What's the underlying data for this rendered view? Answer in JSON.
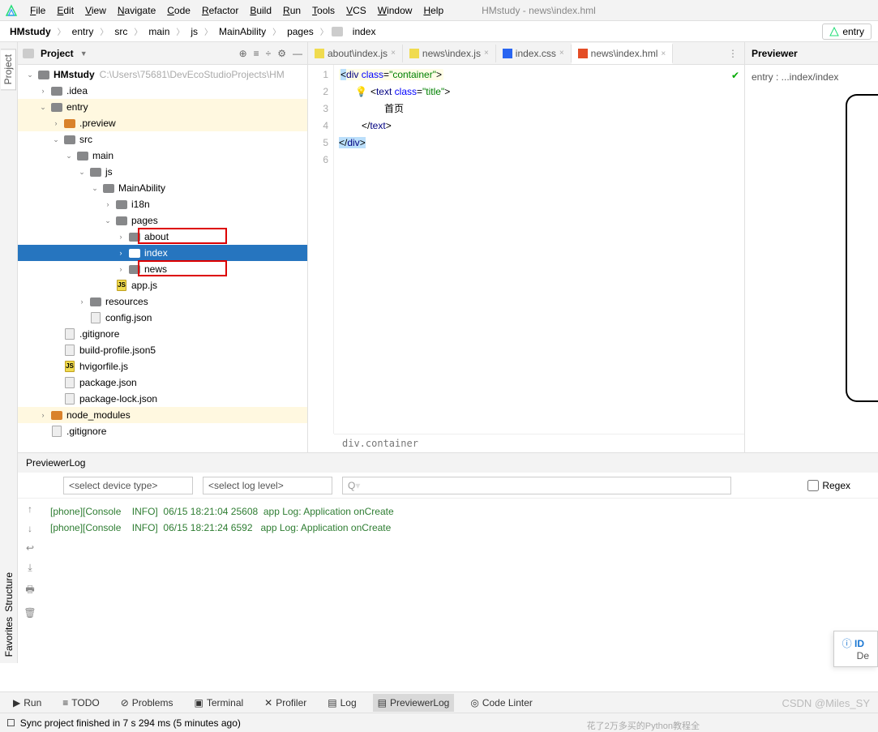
{
  "window_title_path": "HMstudy - news\\index.hml",
  "menubar": [
    "File",
    "Edit",
    "View",
    "Navigate",
    "Code",
    "Refactor",
    "Build",
    "Run",
    "Tools",
    "VCS",
    "Window",
    "Help"
  ],
  "breadcrumbs": [
    "HMstudy",
    "entry",
    "src",
    "main",
    "js",
    "MainAbility",
    "pages",
    "index"
  ],
  "entry_tag": "entry",
  "left_rail_tabs": {
    "project": "Project",
    "structure": "Structure",
    "favorites": "Favorites"
  },
  "project_header": {
    "label": "Project"
  },
  "tree": [
    {
      "indent": 0,
      "chev": "v",
      "ico": "fld",
      "bold": true,
      "label": "HMstudy",
      "hint": "C:\\Users\\75681\\DevEcoStudioProjects\\HM"
    },
    {
      "indent": 1,
      "chev": ">",
      "ico": "fld",
      "label": ".idea"
    },
    {
      "indent": 1,
      "chev": "v",
      "ico": "fld",
      "label": "entry",
      "hl": true
    },
    {
      "indent": 2,
      "chev": ">",
      "ico": "fld-o",
      "label": ".preview",
      "hl": true
    },
    {
      "indent": 2,
      "chev": "v",
      "ico": "fld",
      "label": "src"
    },
    {
      "indent": 3,
      "chev": "v",
      "ico": "fld",
      "label": "main"
    },
    {
      "indent": 4,
      "chev": "v",
      "ico": "fld",
      "label": "js"
    },
    {
      "indent": 5,
      "chev": "v",
      "ico": "fld",
      "label": "MainAbility"
    },
    {
      "indent": 6,
      "chev": ">",
      "ico": "fld",
      "label": "i18n"
    },
    {
      "indent": 6,
      "chev": "v",
      "ico": "fld",
      "label": "pages"
    },
    {
      "indent": 7,
      "chev": ">",
      "ico": "fld",
      "label": "about",
      "red": 1
    },
    {
      "indent": 7,
      "chev": ">",
      "ico": "fld",
      "label": "index",
      "sel": true
    },
    {
      "indent": 7,
      "chev": ">",
      "ico": "fld",
      "label": "news",
      "red": 2
    },
    {
      "indent": 6,
      "chev": "",
      "ico": "js",
      "label": "app.js"
    },
    {
      "indent": 4,
      "chev": ">",
      "ico": "fld",
      "label": "resources"
    },
    {
      "indent": 4,
      "chev": "",
      "ico": "file",
      "label": "config.json"
    },
    {
      "indent": 2,
      "chev": "",
      "ico": "file",
      "label": ".gitignore"
    },
    {
      "indent": 2,
      "chev": "",
      "ico": "file",
      "label": "build-profile.json5"
    },
    {
      "indent": 2,
      "chev": "",
      "ico": "js",
      "label": "hvigorfile.js"
    },
    {
      "indent": 2,
      "chev": "",
      "ico": "file",
      "label": "package.json"
    },
    {
      "indent": 2,
      "chev": "",
      "ico": "file",
      "label": "package-lock.json"
    },
    {
      "indent": 1,
      "chev": ">",
      "ico": "fld-o",
      "label": "node_modules",
      "hl": true
    },
    {
      "indent": 1,
      "chev": "",
      "ico": "file",
      "label": ".gitignore"
    }
  ],
  "editor_tabs": [
    {
      "icon": "js",
      "label": "about\\index.js"
    },
    {
      "icon": "js",
      "label": "news\\index.js"
    },
    {
      "icon": "css",
      "label": "index.css"
    },
    {
      "icon": "hml",
      "label": "news\\index.hml",
      "active": true
    }
  ],
  "code_lines": {
    "l1_a": "div",
    "l1_b": "class",
    "l1_c": "\"container\"",
    "l2_a": "text",
    "l2_b": "class",
    "l2_c": "\"title\"",
    "l3": "首页",
    "l4": "</",
    "l4_b": "text",
    "l4_c": ">",
    "l5": "</",
    "l5_b": "div",
    "l5_c": ">"
  },
  "gutter_lines": [
    "1",
    "2",
    "3",
    "4",
    "5",
    "6"
  ],
  "editor_breadcrumb": "div.container",
  "previewer": {
    "header": "Previewer",
    "label": "entry : ...index/index"
  },
  "log_panel": {
    "title": "PreviewerLog",
    "device_select": "<select device type>",
    "level_select": "<select log level>",
    "search_placeholder": "",
    "regex_label": "Regex",
    "lines": [
      "[phone][Console    INFO]  06/15 18:21:04 25608  app Log: Application onCreate",
      "[phone][Console    INFO]  06/15 18:21:24 6592   app Log: Application onCreate"
    ]
  },
  "id_notif": {
    "title": "ID",
    "sub": "De"
  },
  "bottom_tabs": [
    {
      "icon": "▶",
      "label": "Run"
    },
    {
      "icon": "≡",
      "label": "TODO"
    },
    {
      "icon": "⊘",
      "label": "Problems"
    },
    {
      "icon": "▣",
      "label": "Terminal"
    },
    {
      "icon": "✕",
      "label": "Profiler"
    },
    {
      "icon": "▤",
      "label": "Log"
    },
    {
      "icon": "▤",
      "label": "PreviewerLog",
      "active": true
    },
    {
      "icon": "◎",
      "label": "Code Linter"
    }
  ],
  "statusbar": {
    "left": "Sync project finished in 7 s 294 ms (5 minutes ago)"
  },
  "watermark": "CSDN @Miles_SY",
  "footer_text": "花了2万多买的Python教程全"
}
